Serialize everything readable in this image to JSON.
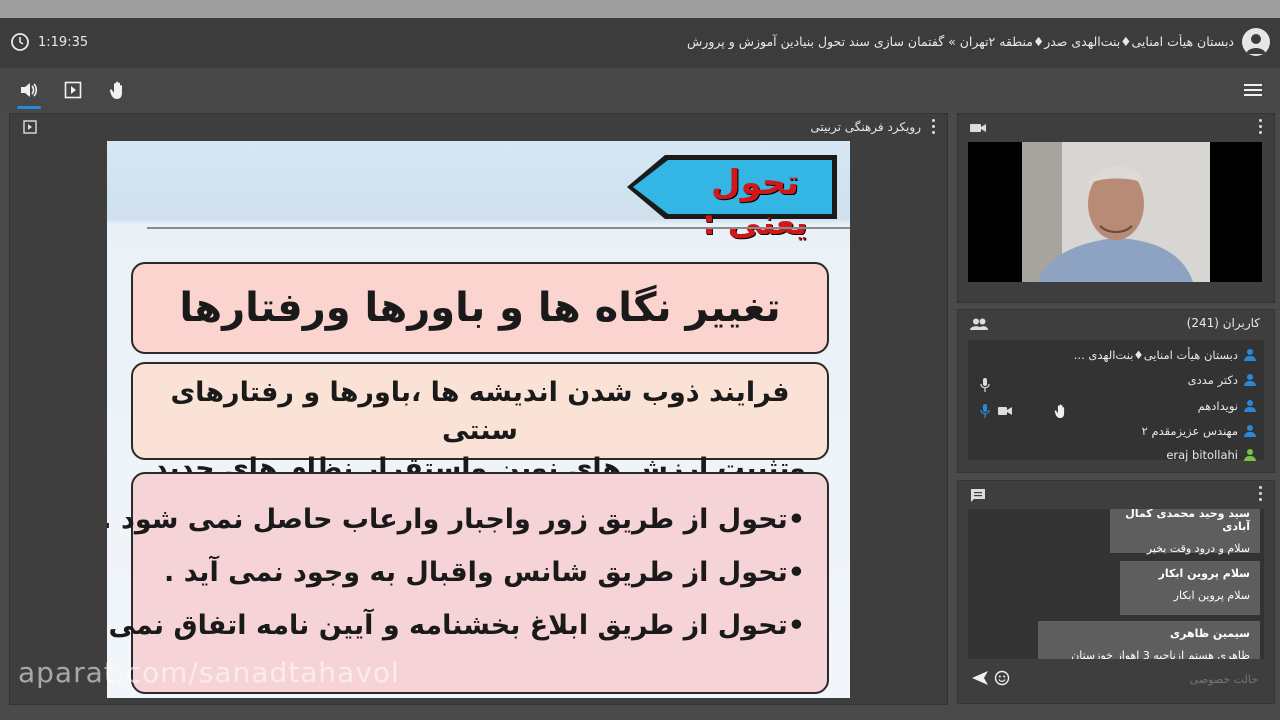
{
  "header": {
    "time": "1:19:35",
    "title": "دبستان هیأت امنایی♦بنت‌الهدی صدر♦منطقه ۲تهران » گفتمان سازی سند تحول بنیادین آموزش و پرورش"
  },
  "toolbar": {
    "items": [
      "speaker-icon",
      "screen-share-icon",
      "raise-hand-icon"
    ],
    "menu_icon": "hamburger-menu-icon"
  },
  "share_pod": {
    "title": "رویکرد فرهنگی تربیتی"
  },
  "slide": {
    "tag": "تحول یعنی :",
    "box1": "تغییر نگاه ها و باورها ورفتارها",
    "box2_line1": "فرایند ذوب شدن اندیشه ها ،باورها و رفتارهای سنتی",
    "box2_line2": "وتثبیت ارزش های نوین واستقرار نظام های جدید",
    "bullets": [
      "•تحول از طریق زور واجبار وارعاب حاصل نمی شود .",
      "•تحول از طریق شانس واقبال به وجود نمی آید .",
      "•تحول از طریق ابلاغ بخشنامه و آیین نامه اتفاق نمی افتد ."
    ]
  },
  "watermark": "aparat.com/sanadtahavol",
  "users_pod": {
    "title": "کاربران (241)",
    "users": [
      {
        "name": "دبستان هیأت امنایی♦بنت‌الهدی ...",
        "color": "#2b88d9"
      },
      {
        "name": "دکتر مددی",
        "color": "#2b88d9"
      },
      {
        "name": "نویدادهم",
        "color": "#2b88d9"
      },
      {
        "name": "مهندس عزیزمقدم ۲",
        "color": "#2b88d9"
      },
      {
        "name": "eraj bitollahi",
        "color": "#7ac143"
      }
    ]
  },
  "chat_pod": {
    "messages": [
      {
        "name": "سید وحید محمدی کمال آبادی",
        "text": "سلام و درود وقت بخیر"
      },
      {
        "name": "سلام پروین ابکار",
        "text": "سلام  پروین ابکار"
      },
      {
        "name": "سیمین ظاهری",
        "text": "ظاهری هستم ازناحیه 3 اهواز خوزستان"
      }
    ],
    "placeholder": "حالت خصوصی"
  }
}
